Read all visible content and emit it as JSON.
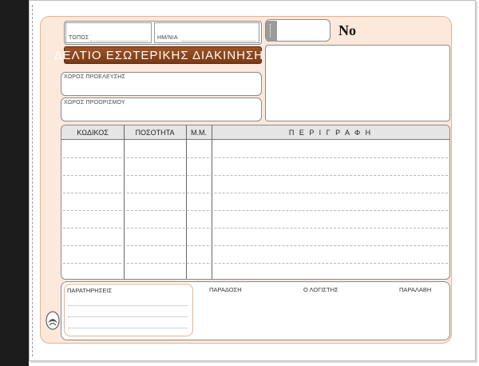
{
  "form": {
    "place_label": "ΤΟΠΟΣ",
    "date_label": "ΗΜ/ΝΙΑ",
    "title": "ΔΕΛΤΙΟ ΕΣΩΤΕΡΙΚΗΣ ΔΙΑΚΙΝΗΣΗΣ",
    "origin_label": "ΧΩΡΟΣ ΠΡΟΕΛΕΥΣΗΣ",
    "destination_label": "ΧΩΡΟΣ ΠΡΟΟΡΙΣΜΟΥ",
    "number_label": "No"
  },
  "table": {
    "headers": [
      "ΚΩΔΙΚΟΣ",
      "ΠΟΣΟΤΗΤΑ",
      "Μ.Μ.",
      "Π Ε Ρ Ι Γ Ρ Α Φ Η"
    ]
  },
  "footer": {
    "remarks_label": "ΠΑΡΑΤΗΡΗΣΕΙΣ",
    "delivery_label": "ΠΑΡΑΔΟΣΗ",
    "accountant_label": "Ο ΛΟΓΙΣΤΗΣ",
    "receipt_label": "ΠΑΡΑΛΑΒΗ"
  }
}
